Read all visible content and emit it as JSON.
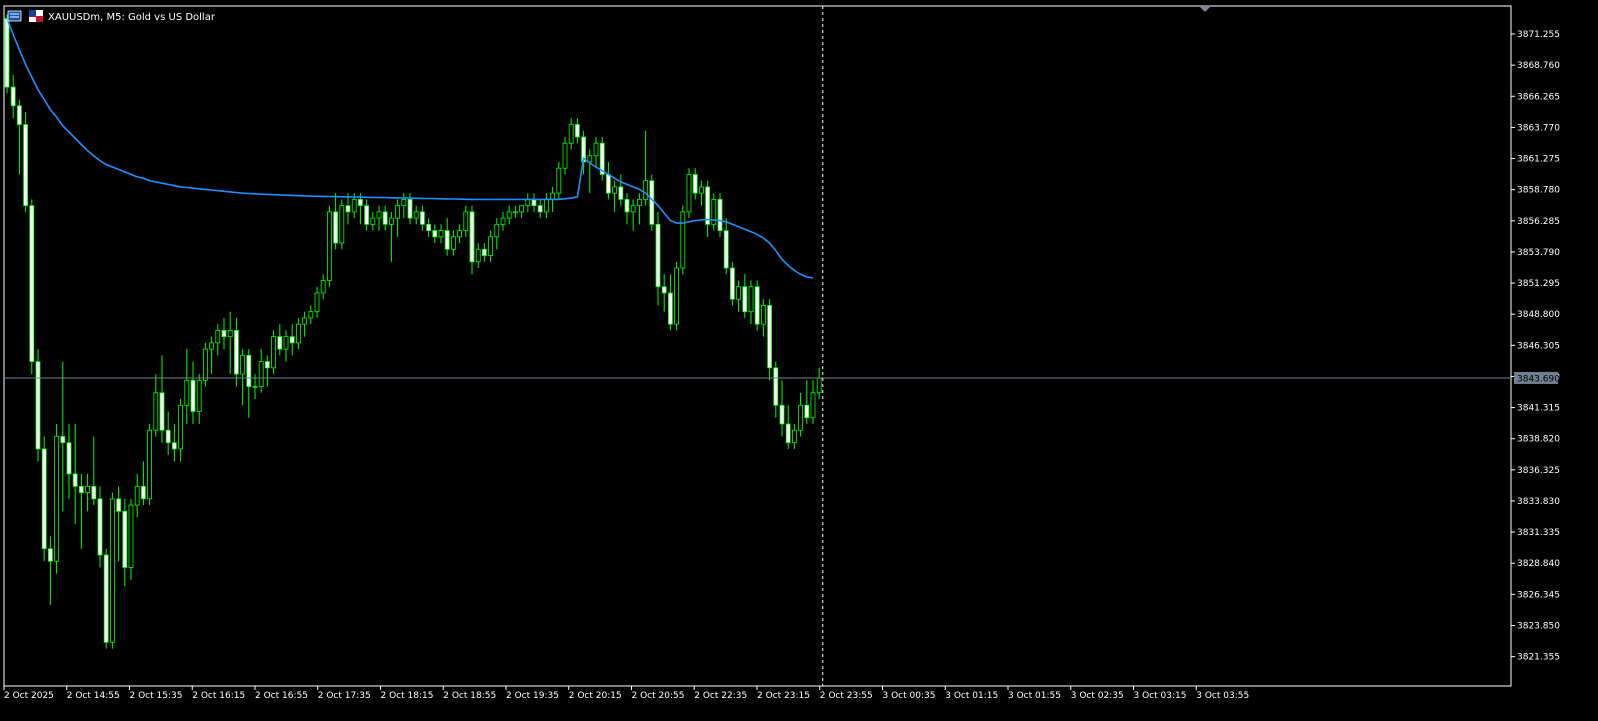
{
  "window": {
    "symbol_title": "XAUUSDm, M5:  Gold vs US Dollar",
    "icons": [
      "chart-window-icon",
      "symbol-flag-icon"
    ]
  },
  "colors": {
    "background": "#000000",
    "bull_body": "#000000",
    "bull_border": "#00ff00",
    "bear_body": "#ffffff",
    "bear_border": "#00ff00",
    "wick": "#00ff00",
    "moving_average": "#1e90ff",
    "axis": "#ffffff",
    "crosshair": "#ffffff",
    "bid_line": "#708090"
  },
  "chart_data": {
    "type": "candlestick",
    "symbol": "XAUUSDm",
    "timeframe": "M5",
    "y_ticks": [
      "3871.255",
      "3868.760",
      "3866.265",
      "3863.770",
      "3861.275",
      "3858.780",
      "3856.285",
      "3853.790",
      "3851.295",
      "3848.800",
      "3846.305",
      "3843.810",
      "3841.315",
      "3838.820",
      "3836.325",
      "3833.830",
      "3831.335",
      "3828.840",
      "3826.345",
      "3823.850",
      "3821.355"
    ],
    "ylim": [
      3820.0,
      3872.8
    ],
    "x_ticks": [
      "2 Oct 2025",
      "2 Oct 14:55",
      "2 Oct 15:35",
      "2 Oct 16:15",
      "2 Oct 16:55",
      "2 Oct 17:35",
      "2 Oct 18:15",
      "2 Oct 18:55",
      "2 Oct 19:35",
      "2 Oct 20:15",
      "2 Oct 20:55",
      "2 Oct 22:35",
      "2 Oct 23:15",
      "2 Oct 23:55",
      "3 Oct 00:35",
      "3 Oct 01:15",
      "3 Oct 01:55",
      "3 Oct 02:35",
      "3 Oct 03:15",
      "3 Oct 03:55"
    ],
    "current_price": "3843.690",
    "crosshair_at": "2 Oct 23:55",
    "ohlc": [
      [
        3872.5,
        3872.8,
        3866.5,
        3867.0
      ],
      [
        3867.0,
        3868.0,
        3864.5,
        3865.5
      ],
      [
        3865.5,
        3866.0,
        3860.0,
        3864.0
      ],
      [
        3864.0,
        3865.0,
        3857.0,
        3857.5
      ],
      [
        3857.5,
        3858.0,
        3844.0,
        3845.0
      ],
      [
        3845.0,
        3846.0,
        3837.0,
        3838.0
      ],
      [
        3838.0,
        3839.0,
        3829.0,
        3830.0
      ],
      [
        3830.0,
        3831.0,
        3825.5,
        3829.0
      ],
      [
        3829.0,
        3840.0,
        3828.0,
        3839.0
      ],
      [
        3839.0,
        3845.0,
        3833.0,
        3838.5
      ],
      [
        3838.5,
        3840.0,
        3834.0,
        3836.0
      ],
      [
        3836.0,
        3840.0,
        3832.0,
        3835.0
      ],
      [
        3835.0,
        3836.0,
        3830.0,
        3834.5
      ],
      [
        3834.5,
        3836.0,
        3833.0,
        3835.0
      ],
      [
        3835.0,
        3839.0,
        3833.5,
        3834.0
      ],
      [
        3834.0,
        3835.0,
        3828.5,
        3829.5
      ],
      [
        3829.5,
        3830.0,
        3822.0,
        3822.5
      ],
      [
        3822.5,
        3834.5,
        3822.0,
        3834.0
      ],
      [
        3834.0,
        3835.0,
        3829.0,
        3833.0
      ],
      [
        3833.0,
        3834.0,
        3827.0,
        3828.5
      ],
      [
        3828.5,
        3834.0,
        3827.5,
        3833.5
      ],
      [
        3833.5,
        3836.0,
        3832.5,
        3835.0
      ],
      [
        3835.0,
        3837.0,
        3833.5,
        3834.0
      ],
      [
        3834.0,
        3840.0,
        3833.5,
        3839.5
      ],
      [
        3839.5,
        3844.0,
        3839.0,
        3842.5
      ],
      [
        3842.5,
        3845.5,
        3838.5,
        3839.5
      ],
      [
        3839.5,
        3841.0,
        3837.5,
        3838.5
      ],
      [
        3838.5,
        3840.0,
        3837.0,
        3838.0
      ],
      [
        3838.0,
        3842.0,
        3837.0,
        3841.5
      ],
      [
        3841.5,
        3846.0,
        3840.0,
        3843.5
      ],
      [
        3843.5,
        3845.0,
        3840.0,
        3841.0
      ],
      [
        3841.0,
        3844.0,
        3840.0,
        3843.5
      ],
      [
        3843.5,
        3846.5,
        3843.0,
        3846.0
      ],
      [
        3846.0,
        3847.0,
        3844.0,
        3846.5
      ],
      [
        3846.5,
        3848.0,
        3845.5,
        3847.5
      ],
      [
        3847.5,
        3848.5,
        3846.0,
        3847.0
      ],
      [
        3847.0,
        3849.0,
        3844.0,
        3847.5
      ],
      [
        3847.5,
        3848.5,
        3843.0,
        3844.0
      ],
      [
        3844.0,
        3846.0,
        3841.5,
        3845.5
      ],
      [
        3845.5,
        3846.0,
        3840.5,
        3843.0
      ],
      [
        3843.0,
        3844.0,
        3842.0,
        3843.0
      ],
      [
        3843.0,
        3846.0,
        3842.5,
        3845.0
      ],
      [
        3845.0,
        3845.5,
        3843.0,
        3844.5
      ],
      [
        3844.5,
        3847.5,
        3844.0,
        3847.0
      ],
      [
        3847.0,
        3848.0,
        3845.5,
        3846.0
      ],
      [
        3846.0,
        3847.5,
        3845.0,
        3847.0
      ],
      [
        3847.0,
        3848.0,
        3845.5,
        3846.5
      ],
      [
        3846.5,
        3848.5,
        3846.0,
        3848.0
      ],
      [
        3848.0,
        3849.0,
        3847.0,
        3848.5
      ],
      [
        3848.5,
        3849.5,
        3848.0,
        3849.0
      ],
      [
        3849.0,
        3851.0,
        3848.5,
        3850.5
      ],
      [
        3850.5,
        3852.0,
        3850.0,
        3851.5
      ],
      [
        3851.5,
        3857.5,
        3851.0,
        3857.0
      ],
      [
        3857.0,
        3858.5,
        3854.0,
        3854.5
      ],
      [
        3854.5,
        3858.0,
        3854.0,
        3857.5
      ],
      [
        3857.5,
        3858.5,
        3856.0,
        3857.0
      ],
      [
        3857.0,
        3858.5,
        3856.5,
        3858.0
      ],
      [
        3858.0,
        3858.5,
        3856.0,
        3857.5
      ],
      [
        3857.5,
        3858.0,
        3855.5,
        3856.0
      ],
      [
        3856.0,
        3857.0,
        3855.5,
        3856.5
      ],
      [
        3856.5,
        3857.5,
        3855.5,
        3857.0
      ],
      [
        3857.0,
        3857.5,
        3855.5,
        3856.0
      ],
      [
        3856.0,
        3857.0,
        3853.0,
        3856.5
      ],
      [
        3856.5,
        3858.0,
        3855.0,
        3857.5
      ],
      [
        3857.5,
        3858.5,
        3856.5,
        3858.0
      ],
      [
        3858.0,
        3858.5,
        3856.0,
        3856.5
      ],
      [
        3856.5,
        3857.5,
        3856.0,
        3857.0
      ],
      [
        3857.0,
        3857.5,
        3855.5,
        3856.0
      ],
      [
        3856.0,
        3856.5,
        3855.0,
        3855.5
      ],
      [
        3855.5,
        3856.0,
        3854.5,
        3855.0
      ],
      [
        3855.0,
        3856.0,
        3854.5,
        3855.5
      ],
      [
        3855.5,
        3856.5,
        3853.5,
        3854.0
      ],
      [
        3854.0,
        3855.5,
        3853.5,
        3855.0
      ],
      [
        3855.0,
        3856.0,
        3854.5,
        3855.5
      ],
      [
        3855.5,
        3857.5,
        3855.0,
        3857.0
      ],
      [
        3857.0,
        3857.5,
        3852.0,
        3853.0
      ],
      [
        3853.0,
        3854.5,
        3852.5,
        3854.0
      ],
      [
        3854.0,
        3854.5,
        3853.0,
        3853.5
      ],
      [
        3853.5,
        3855.5,
        3853.0,
        3855.0
      ],
      [
        3855.0,
        3856.5,
        3854.0,
        3856.0
      ],
      [
        3856.0,
        3857.0,
        3855.5,
        3856.5
      ],
      [
        3856.5,
        3857.5,
        3856.0,
        3857.0
      ],
      [
        3857.0,
        3857.5,
        3856.5,
        3857.0
      ],
      [
        3857.0,
        3857.5,
        3856.5,
        3857.5
      ],
      [
        3857.5,
        3858.5,
        3857.0,
        3858.0
      ],
      [
        3858.0,
        3858.5,
        3857.0,
        3857.5
      ],
      [
        3857.5,
        3858.0,
        3856.5,
        3857.0
      ],
      [
        3857.0,
        3858.5,
        3856.5,
        3858.0
      ],
      [
        3858.0,
        3859.0,
        3857.0,
        3858.5
      ],
      [
        3858.5,
        3861.0,
        3858.0,
        3860.5
      ],
      [
        3860.5,
        3863.0,
        3860.0,
        3862.5
      ],
      [
        3862.5,
        3864.5,
        3862.0,
        3864.0
      ],
      [
        3864.0,
        3864.5,
        3862.5,
        3863.0
      ],
      [
        3863.0,
        3863.5,
        3860.0,
        3861.0
      ],
      [
        3861.0,
        3862.0,
        3858.5,
        3861.5
      ],
      [
        3861.5,
        3863.0,
        3860.5,
        3862.5
      ],
      [
        3862.5,
        3863.0,
        3859.5,
        3860.0
      ],
      [
        3860.0,
        3861.0,
        3858.0,
        3858.5
      ],
      [
        3858.5,
        3859.5,
        3857.0,
        3859.0
      ],
      [
        3859.0,
        3860.0,
        3857.5,
        3858.0
      ],
      [
        3858.0,
        3858.5,
        3856.0,
        3857.0
      ],
      [
        3857.0,
        3858.0,
        3855.5,
        3857.5
      ],
      [
        3857.5,
        3858.5,
        3856.0,
        3858.0
      ],
      [
        3858.0,
        3863.5,
        3857.5,
        3859.5
      ],
      [
        3859.5,
        3860.0,
        3855.5,
        3856.0
      ],
      [
        3856.0,
        3857.0,
        3849.5,
        3851.0
      ],
      [
        3851.0,
        3852.0,
        3849.0,
        3850.5
      ],
      [
        3850.5,
        3852.0,
        3847.5,
        3848.0
      ],
      [
        3848.0,
        3853.0,
        3847.5,
        3852.5
      ],
      [
        3852.5,
        3857.5,
        3852.0,
        3857.0
      ],
      [
        3857.0,
        3860.5,
        3856.5,
        3860.0
      ],
      [
        3860.0,
        3860.5,
        3858.0,
        3858.5
      ],
      [
        3858.5,
        3859.5,
        3857.5,
        3859.0
      ],
      [
        3859.0,
        3859.5,
        3855.0,
        3856.0
      ],
      [
        3856.0,
        3858.5,
        3855.5,
        3858.0
      ],
      [
        3858.0,
        3858.5,
        3855.0,
        3855.5
      ],
      [
        3855.5,
        3856.5,
        3852.0,
        3852.5
      ],
      [
        3852.5,
        3853.0,
        3849.5,
        3850.0
      ],
      [
        3850.0,
        3851.5,
        3849.0,
        3851.0
      ],
      [
        3851.0,
        3852.0,
        3848.5,
        3849.0
      ],
      [
        3849.0,
        3851.5,
        3848.0,
        3851.0
      ],
      [
        3851.0,
        3851.5,
        3847.5,
        3848.0
      ],
      [
        3848.0,
        3850.0,
        3847.0,
        3849.5
      ],
      [
        3849.5,
        3850.0,
        3843.5,
        3844.5
      ],
      [
        3844.5,
        3845.0,
        3840.5,
        3841.5
      ],
      [
        3841.5,
        3843.5,
        3839.0,
        3840.0
      ],
      [
        3840.0,
        3841.5,
        3838.0,
        3838.5
      ],
      [
        3838.5,
        3840.0,
        3838.0,
        3839.5
      ],
      [
        3839.5,
        3842.5,
        3839.0,
        3841.5
      ],
      [
        3841.5,
        3843.5,
        3840.0,
        3840.5
      ],
      [
        3840.5,
        3843.5,
        3840.0,
        3842.5
      ],
      [
        3842.5,
        3844.5,
        3842.0,
        3843.7
      ]
    ],
    "moving_average": [
      3872.5,
      3871.2,
      3870.0,
      3868.8,
      3867.8,
      3866.8,
      3866.0,
      3865.2,
      3864.6,
      3863.9,
      3863.4,
      3862.9,
      3862.4,
      3861.9,
      3861.5,
      3861.1,
      3860.8,
      3860.6,
      3860.4,
      3860.2,
      3860.0,
      3859.8,
      3859.7,
      3859.5,
      3859.4,
      3859.3,
      3859.2,
      3859.1,
      3859.0,
      3858.95,
      3858.9,
      3858.85,
      3858.8,
      3858.75,
      3858.7,
      3858.65,
      3858.6,
      3858.55,
      3858.5,
      3858.47,
      3858.45,
      3858.42,
      3858.4,
      3858.38,
      3858.36,
      3858.34,
      3858.32,
      3858.3,
      3858.28,
      3858.26,
      3858.25,
      3858.24,
      3858.23,
      3858.22,
      3858.21,
      3858.2,
      3858.19,
      3858.18,
      3858.17,
      3858.16,
      3858.15,
      3858.14,
      3858.13,
      3858.12,
      3858.11,
      3858.1,
      3858.09,
      3858.08,
      3858.07,
      3858.06,
      3858.05,
      3858.04,
      3858.03,
      3858.02,
      3858.01,
      3858.0,
      3858.0,
      3858.0,
      3858.0,
      3858.0,
      3858.0,
      3858.0,
      3858.0,
      3858.0,
      3858.0,
      3858.0,
      3858.0,
      3858.0,
      3858.0,
      3858.0,
      3858.05,
      3858.1,
      3858.2,
      3861.3,
      3860.9,
      3860.6,
      3860.3,
      3860.0,
      3859.7,
      3859.4,
      3859.2,
      3859.0,
      3858.8,
      3858.5,
      3858.0,
      3857.5,
      3856.9,
      3856.3,
      3856.1,
      3856.1,
      3856.2,
      3856.3,
      3856.35,
      3856.4,
      3856.35,
      3856.3,
      3856.2,
      3856.0,
      3855.8,
      3855.6,
      3855.4,
      3855.2,
      3854.9,
      3854.5,
      3853.9,
      3853.2,
      3852.7,
      3852.3,
      3852.0,
      3851.8,
      3851.7
    ]
  }
}
